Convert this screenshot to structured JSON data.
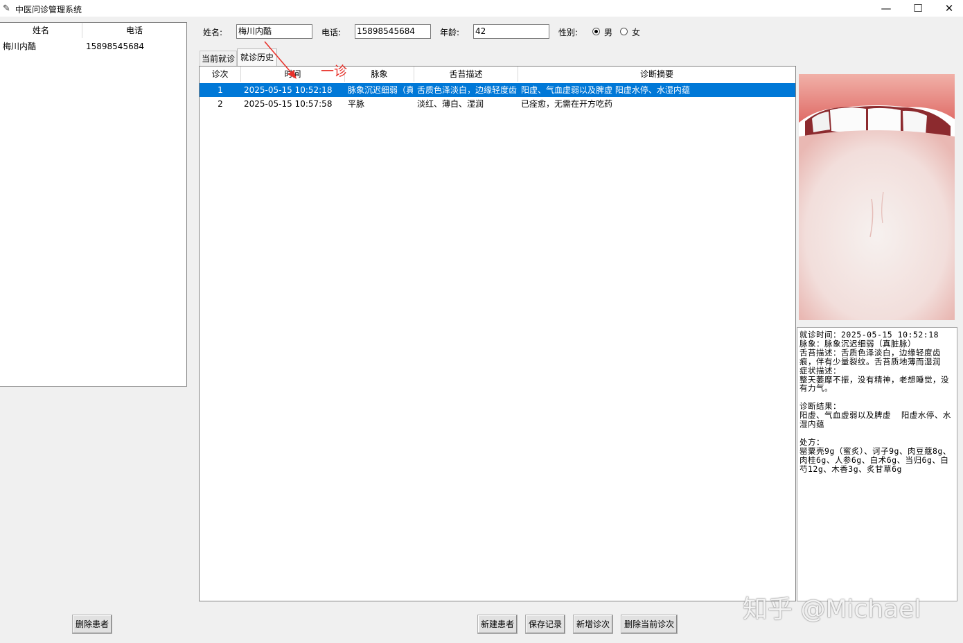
{
  "window": {
    "title": "中医问诊管理系统",
    "minimize": "—",
    "maximize": "☐",
    "close": "✕"
  },
  "patient_list": {
    "columns": [
      "姓名",
      "电话"
    ],
    "rows": [
      {
        "name": "梅川内酷",
        "phone": "15898545684"
      }
    ]
  },
  "form": {
    "name_label": "姓名:",
    "name_value": "梅川内酷",
    "phone_label": "电话:",
    "phone_value": "15898545684",
    "age_label": "年龄:",
    "age_value": "42",
    "gender_label": "性别:",
    "male": "男",
    "female": "女",
    "gender_selected": "男"
  },
  "tabs": {
    "current": "当前就诊",
    "history": "就诊历史",
    "active": "就诊历史"
  },
  "annotation": {
    "text": "一诊",
    "color": "#e8322b"
  },
  "history_table": {
    "columns": [
      "诊次",
      "时间",
      "脉象",
      "舌苔描述",
      "诊断摘要"
    ],
    "rows": [
      {
        "no": "1",
        "time": "2025-05-15 10:52:18",
        "pulse": "脉象沉迟细弱（真",
        "tongue": "舌质色泽淡白，边缘轻度齿",
        "summary": "阳虚、气血虚弱以及脾虚  阳虚水停、水湿内蕴",
        "selected": true
      },
      {
        "no": "2",
        "time": "2025-05-15 10:57:58",
        "pulse": "平脉",
        "tongue": "淡红、薄白、湿润",
        "summary": "已痊愈，无需在开方吃药",
        "selected": false
      }
    ]
  },
  "detail_text": "就诊时间：2025-05-15 10:52:18\n脉象：脉象沉迟细弱（真脏脉）\n舌苔描述：舌质色泽淡白，边缘轻度齿痕，伴有少量裂纹。舌苔质地薄而湿润\n症状描述：\n整天萎靡不振，没有精神，老想睡觉，没有力气。\n\n诊断结果：\n阳虚、气血虚弱以及脾虚  阳虚水停、水湿内蕴\n\n处方：\n罂粟壳9g（蜜炙）、诃子9g、肉豆蔻8g、肉桂6g、人参6g、白术6g、当归6g、白芍12g、木香3g、炙甘草6g",
  "buttons": {
    "delete_patient": "删除患者",
    "new_patient": "新建患者",
    "save_record": "保存记录",
    "new_visit": "新增诊次",
    "delete_visit": "删除当前诊次"
  },
  "watermark": "知乎 @Michael",
  "colors": {
    "selection": "#0078d7",
    "accent_red": "#e8322b"
  }
}
